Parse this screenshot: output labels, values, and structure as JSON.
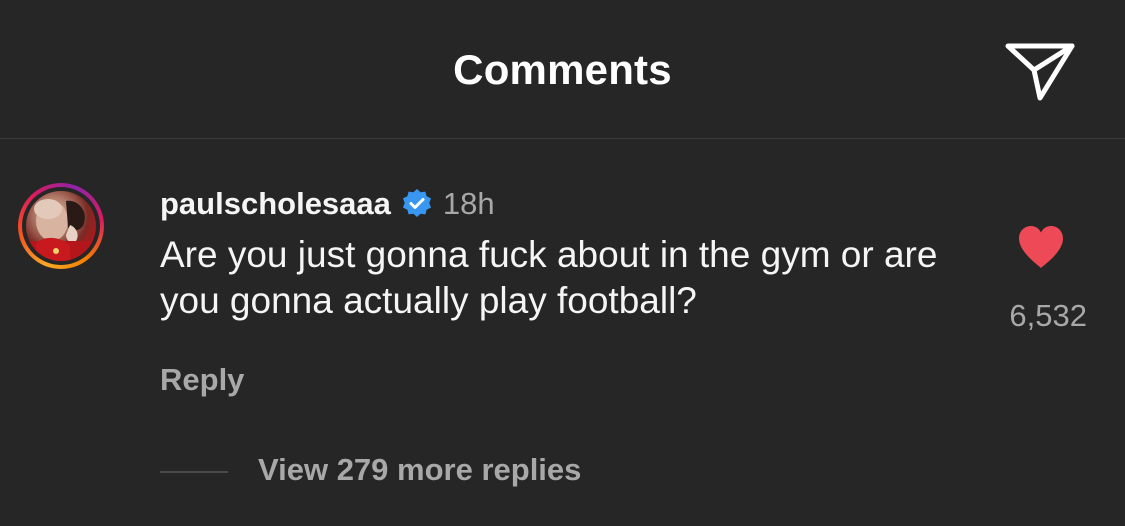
{
  "header": {
    "title": "Comments",
    "share_icon": "paper-plane-icon"
  },
  "comment": {
    "avatar_icon": "profile-photo",
    "username": "paulscholesaaa",
    "verified_icon": "verified-badge-icon",
    "time": "18h",
    "text": "Are you just gonna fuck about in the gym or are you gonna actually play football?",
    "reply_label": "Reply",
    "like_icon": "heart-filled-icon",
    "like_count": "6,532",
    "view_replies_label": "View 279 more replies"
  },
  "colors": {
    "background": "#262626",
    "heart": "#ed4956",
    "verified": "#3897f0",
    "secondary_text": "#a8a8a8"
  }
}
